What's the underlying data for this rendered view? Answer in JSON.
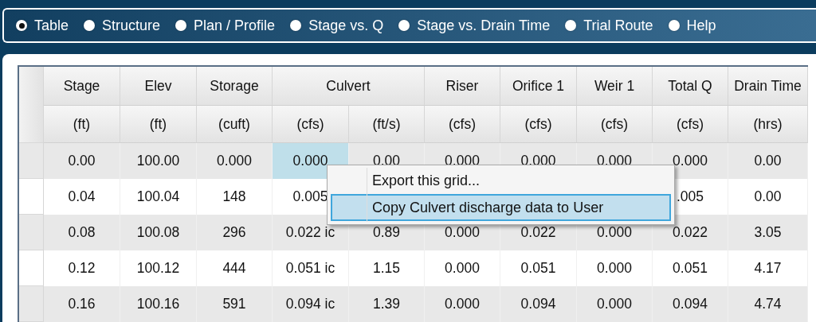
{
  "tabs": [
    {
      "label": "Table",
      "selected": true
    },
    {
      "label": "Structure",
      "selected": false
    },
    {
      "label": "Plan / Profile",
      "selected": false
    },
    {
      "label": "Stage vs. Q",
      "selected": false
    },
    {
      "label": "Stage vs. Drain Time",
      "selected": false
    },
    {
      "label": "Trial Route",
      "selected": false
    },
    {
      "label": "Help",
      "selected": false
    }
  ],
  "table": {
    "columns": [
      {
        "label": "Stage",
        "units": [
          "(ft)"
        ]
      },
      {
        "label": "Elev",
        "units": [
          "(ft)"
        ]
      },
      {
        "label": "Storage",
        "units": [
          "(cuft)"
        ]
      },
      {
        "label": "Culvert",
        "units": [
          "(cfs)"
        ]
      },
      {
        "units": [
          "(ft/s)"
        ]
      },
      {
        "label": "Riser",
        "units": [
          "(cfs)"
        ]
      },
      {
        "label": "Orifice 1",
        "units": [
          "(cfs)"
        ]
      },
      {
        "label": "Weir 1",
        "units": [
          "(cfs)"
        ]
      },
      {
        "label": "Total Q",
        "units": [
          "(cfs)"
        ]
      },
      {
        "label": "Drain Time",
        "units": [
          "(hrs)"
        ]
      }
    ],
    "rows": [
      {
        "cells": [
          {
            "text": "0.00",
            "selected": false
          },
          {
            "text": "100.00",
            "selected": false
          },
          {
            "text": "0.000",
            "selected": false
          },
          {
            "text": "0.000",
            "selected": true
          },
          {
            "text": "0.00",
            "selected": false
          },
          {
            "text": "0.000",
            "selected": false
          },
          {
            "text": "0.000",
            "selected": false
          },
          {
            "text": "0.000",
            "selected": false
          },
          {
            "text": "0.000",
            "selected": false
          },
          {
            "text": "0.00",
            "selected": false
          }
        ]
      },
      {
        "cells": [
          {
            "text": "0.04",
            "selected": false
          },
          {
            "text": "100.04",
            "selected": false
          },
          {
            "text": "148",
            "selected": false
          },
          {
            "text": "0.005",
            "selected": false
          },
          null,
          null,
          null,
          null,
          {
            "text": ".005",
            "selected": false
          },
          {
            "text": "0.00",
            "selected": false
          }
        ]
      },
      {
        "cells": [
          {
            "text": "0.08",
            "selected": false
          },
          {
            "text": "100.08",
            "selected": false
          },
          {
            "text": "296",
            "selected": false
          },
          {
            "text": "0.022 ic",
            "selected": false
          },
          {
            "text": "0.89",
            "selected": false
          },
          {
            "text": "0.000",
            "selected": false
          },
          {
            "text": "0.022",
            "selected": false
          },
          {
            "text": "0.000",
            "selected": false
          },
          {
            "text": "0.022",
            "selected": false
          },
          {
            "text": "3.05",
            "selected": false
          }
        ]
      },
      {
        "cells": [
          {
            "text": "0.12",
            "selected": false
          },
          {
            "text": "100.12",
            "selected": false
          },
          {
            "text": "444",
            "selected": false
          },
          {
            "text": "0.051 ic",
            "selected": false
          },
          {
            "text": "1.15",
            "selected": false
          },
          {
            "text": "0.000",
            "selected": false
          },
          {
            "text": "0.051",
            "selected": false
          },
          {
            "text": "0.000",
            "selected": false
          },
          {
            "text": "0.051",
            "selected": false
          },
          {
            "text": "4.17",
            "selected": false
          }
        ]
      },
      {
        "cells": [
          {
            "text": "0.16",
            "selected": false
          },
          {
            "text": "100.16",
            "selected": false
          },
          {
            "text": "591",
            "selected": false
          },
          {
            "text": "0.094 ic",
            "selected": false
          },
          {
            "text": "1.39",
            "selected": false
          },
          {
            "text": "0.000",
            "selected": false
          },
          {
            "text": "0.094",
            "selected": false
          },
          {
            "text": "0.000",
            "selected": false
          },
          {
            "text": "0.094",
            "selected": false
          },
          {
            "text": "4.74",
            "selected": false
          }
        ]
      }
    ]
  },
  "context_menu": {
    "items": [
      {
        "label": "Export this grid...",
        "selected": false
      },
      {
        "label": "Copy Culvert discharge data to User",
        "selected": true
      }
    ]
  }
}
